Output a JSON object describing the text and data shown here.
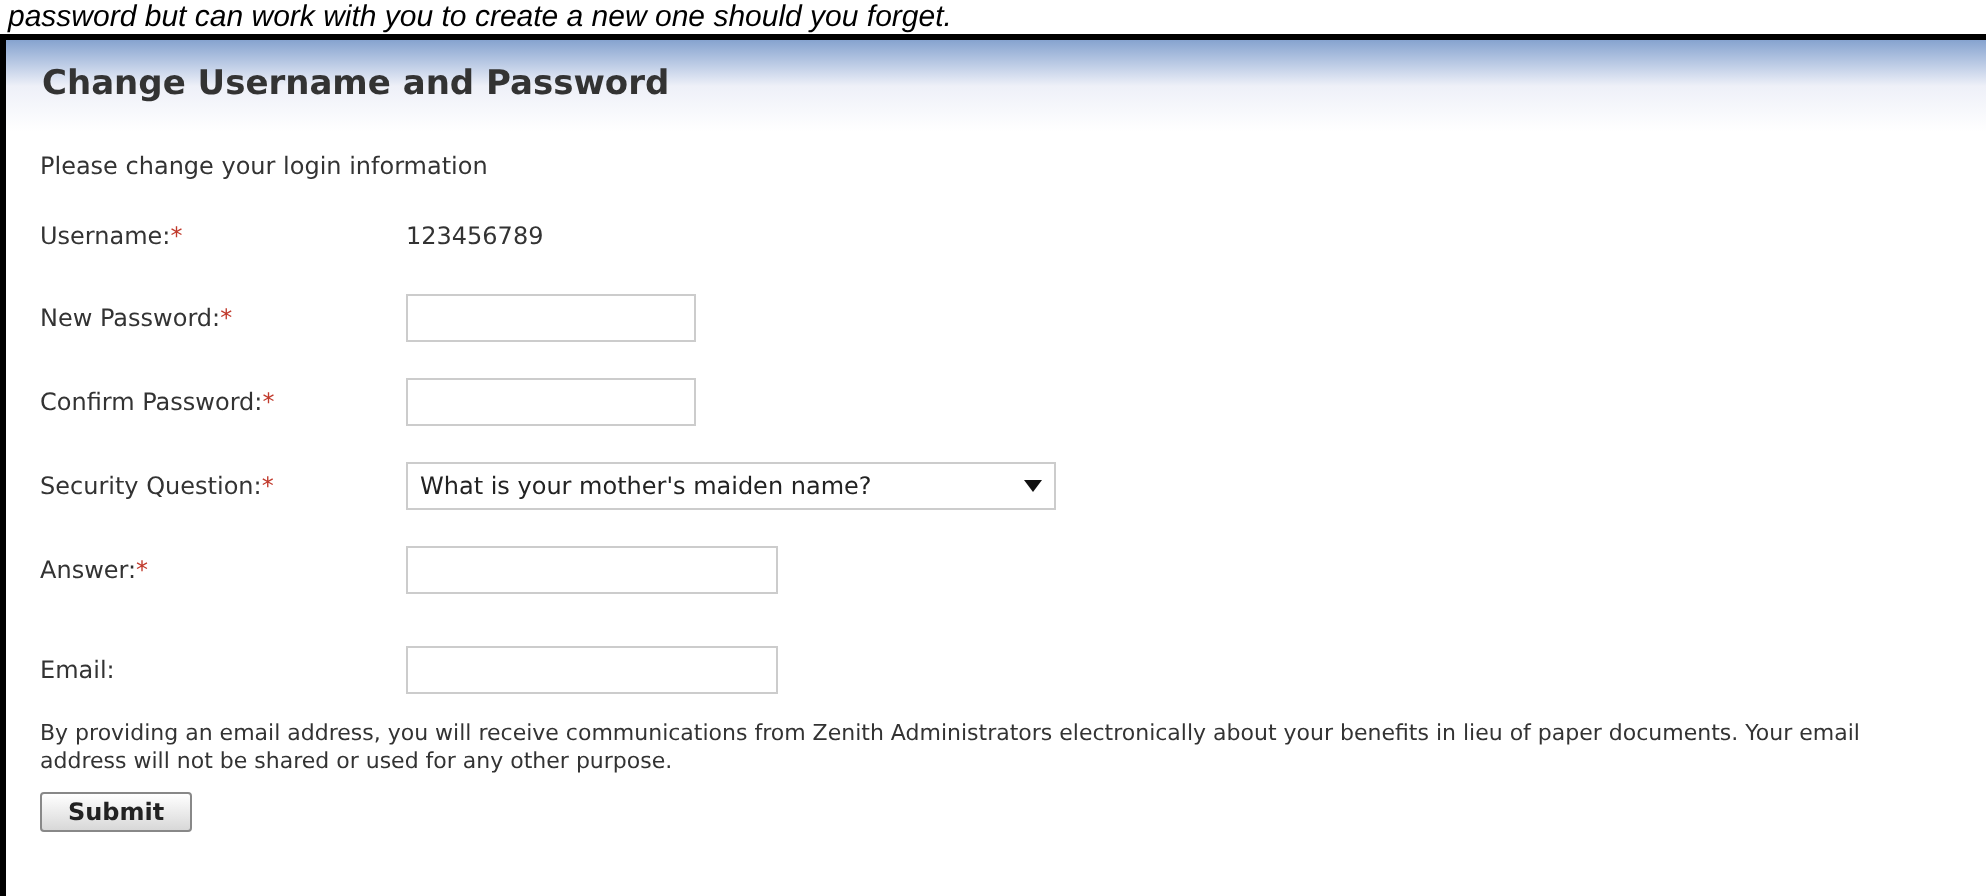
{
  "caption": "password but can work with you to create a new one should you forget.",
  "title": "Change Username and Password",
  "intro": "Please change your login information",
  "fields": [
    {
      "kind": "text",
      "label": "Username:",
      "mark": "*",
      "value": "123456789"
    },
    {
      "kind": "short_input",
      "label": "New Password:",
      "mark": "*"
    },
    {
      "kind": "short_input",
      "label": "Confirm Password:",
      "mark": "*"
    },
    {
      "kind": "select",
      "label": "Security Question:",
      "mark": "*",
      "value": "What is your mother's maiden name?"
    },
    {
      "kind": "long_input",
      "label": "Answer:",
      "mark": "*"
    },
    {
      "kind": "long_input",
      "label": "Email:"
    }
  ],
  "notice": "By providing an email address, you will receive communications from Zenith Administrators electronically about your benefits in lieu of paper documents. Your email address will not be shared or used for any other purpose.",
  "submit": "Submit"
}
